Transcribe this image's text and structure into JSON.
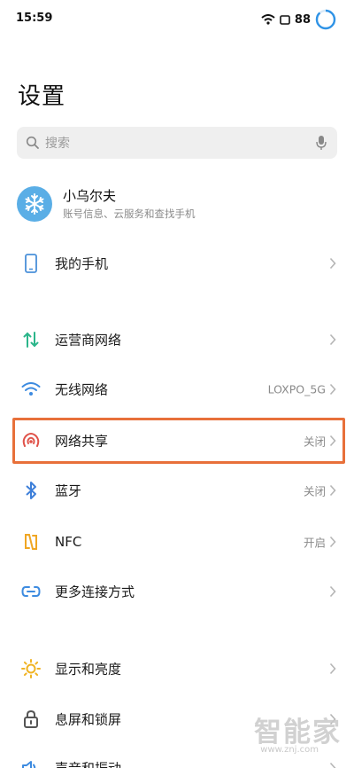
{
  "status_bar": {
    "time": "15:59",
    "battery": "88",
    "icons": [
      "wifi-icon",
      "screen-icon",
      "battery-ring-icon"
    ]
  },
  "title": "设置",
  "search": {
    "placeholder": "搜索",
    "icon": "search-icon",
    "voice_icon": "mic-icon"
  },
  "account": {
    "name": "小乌尔夫",
    "subtitle": "账号信息、云服务和查找手机",
    "avatar_icon": "snowflake-icon"
  },
  "rows": [
    {
      "label": "我的手机",
      "value": "",
      "icon": "phone-icon",
      "icon_color": "#4a90d9"
    },
    {
      "label": "运营商网络",
      "value": "",
      "icon": "updown-arrows-icon",
      "icon_color": "#2bb58a"
    },
    {
      "label": "无线网络",
      "value": "LOXPO_5G",
      "icon": "wifi-icon",
      "icon_color": "#3d8be0"
    },
    {
      "label": "网络共享",
      "value": "关闭",
      "icon": "hotspot-icon",
      "icon_color": "#e0534a"
    },
    {
      "label": "蓝牙",
      "value": "关闭",
      "icon": "bluetooth-icon",
      "icon_color": "#3d7fd9"
    },
    {
      "label": "NFC",
      "value": "开启",
      "icon": "nfc-icon",
      "icon_color": "#f0a623"
    },
    {
      "label": "更多连接方式",
      "value": "",
      "icon": "link-icon",
      "icon_color": "#3d8be0"
    },
    {
      "label": "显示和亮度",
      "value": "",
      "icon": "sun-icon",
      "icon_color": "#f0b323"
    },
    {
      "label": "息屏和锁屏",
      "value": "",
      "icon": "lock-icon",
      "icon_color": "#555555"
    },
    {
      "label": "声音和振动",
      "value": "",
      "icon": "speaker-icon",
      "icon_color": "#3d8be0"
    }
  ],
  "highlight_color": "#e8703a",
  "watermark": {
    "text": "智能家",
    "url": "www.znj.com"
  }
}
